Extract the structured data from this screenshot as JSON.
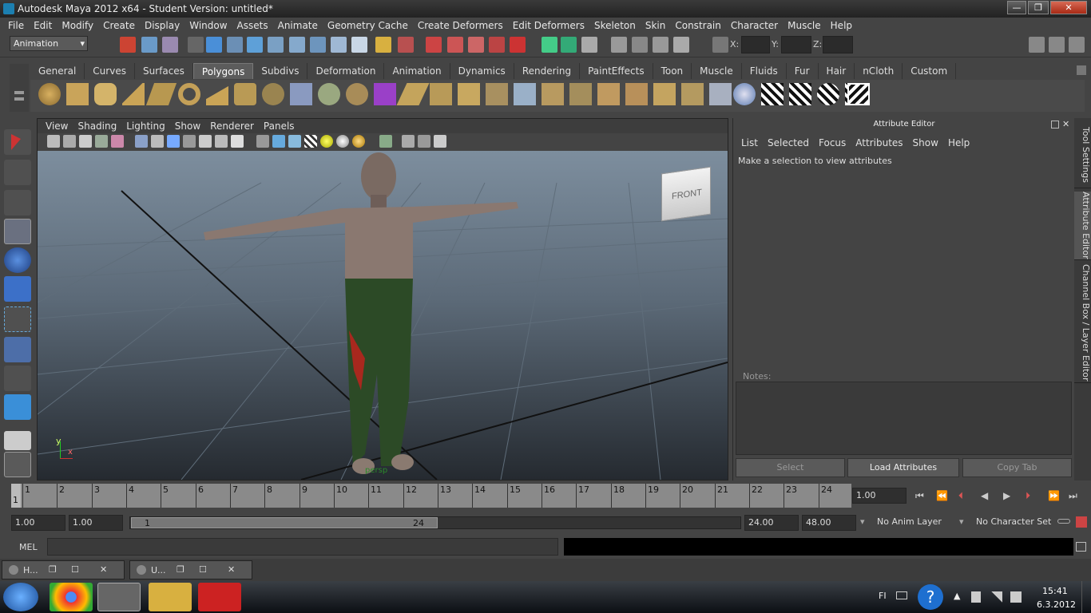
{
  "window": {
    "title": "Autodesk Maya 2012 x64 - Student Version: untitled*",
    "controls": [
      "—",
      "❐",
      "✕"
    ]
  },
  "menu": [
    "File",
    "Edit",
    "Modify",
    "Create",
    "Display",
    "Window",
    "Assets",
    "Animate",
    "Geometry Cache",
    "Create Deformers",
    "Edit Deformers",
    "Skeleton",
    "Skin",
    "Constrain",
    "Character",
    "Muscle",
    "Help"
  ],
  "status": {
    "mode": "Animation",
    "x_label": "X:",
    "y_label": "Y:",
    "z_label": "Z:"
  },
  "shelf": {
    "tabs": [
      "General",
      "Curves",
      "Surfaces",
      "Polygons",
      "Subdivs",
      "Deformation",
      "Animation",
      "Dynamics",
      "Rendering",
      "PaintEffects",
      "Toon",
      "Muscle",
      "Fluids",
      "Fur",
      "Hair",
      "nCloth",
      "Custom"
    ],
    "active_tab": "Polygons"
  },
  "viewport": {
    "menu": [
      "View",
      "Shading",
      "Lighting",
      "Show",
      "Renderer",
      "Panels"
    ],
    "viewcube_label": "FRONT",
    "axis_y": "y",
    "axis_x": "x",
    "camera": "persp"
  },
  "attribute_editor": {
    "title": "Attribute Editor",
    "menu": [
      "List",
      "Selected",
      "Focus",
      "Attributes",
      "Show",
      "Help"
    ],
    "message": "Make a selection to view attributes",
    "notes_label": "Notes:",
    "buttons": [
      "Select",
      "Load Attributes",
      "Copy Tab"
    ]
  },
  "side_tabs": [
    "Tool Settings",
    "Attribute Editor",
    "Channel Box / Layer Editor"
  ],
  "timeline": {
    "labels": [
      "1",
      "2",
      "3",
      "4",
      "5",
      "6",
      "7",
      "8",
      "9",
      "10",
      "11",
      "12",
      "13",
      "14",
      "15",
      "16",
      "17",
      "18",
      "19",
      "20",
      "21",
      "22",
      "23",
      "24"
    ],
    "current_frame": "1",
    "current_time_field": "1.00"
  },
  "playback_icons": [
    "⏮",
    "⏪",
    "⏴",
    "◀",
    "▶",
    "⏵",
    "⏩",
    "⏭"
  ],
  "range": {
    "start": "1.00",
    "playback_start": "1.00",
    "slider_start": "1",
    "slider_end": "24",
    "playback_end": "24.00",
    "end": "48.00",
    "anim_layer": "No Anim Layer",
    "character_set": "No Character Set"
  },
  "mel_label": "MEL",
  "minimized": [
    "H...",
    "U..."
  ],
  "taskbar": {
    "lang": "FI",
    "time": "15:41",
    "date": "6.3.2012"
  },
  "colors": {
    "viewport_bg_top": "#7d8e9e",
    "viewport_bg_bottom": "#252a30",
    "panel": "#444444"
  }
}
